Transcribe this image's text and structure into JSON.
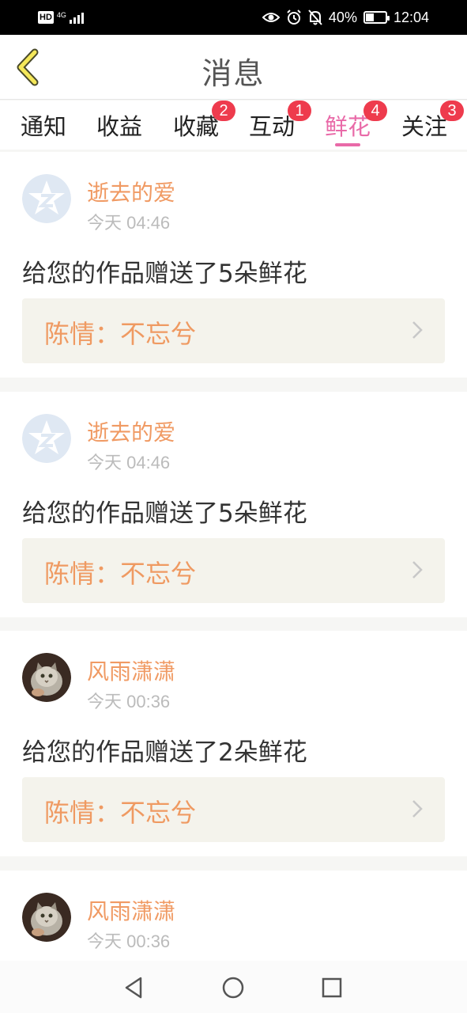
{
  "status_bar": {
    "hd": "HD",
    "network": "4G",
    "battery": "40%",
    "battery_level": 0.4,
    "time": "12:04"
  },
  "header": {
    "title": "消息",
    "back_icon": "chevron-left-icon"
  },
  "tabs": [
    {
      "label": "通知",
      "badge": ""
    },
    {
      "label": "收益",
      "badge": ""
    },
    {
      "label": "收藏",
      "badge": "2"
    },
    {
      "label": "互动",
      "badge": "1"
    },
    {
      "label": "鲜花",
      "badge": "4",
      "active": true
    },
    {
      "label": "关注",
      "badge": "3"
    }
  ],
  "messages": [
    {
      "user": "逝去的爱",
      "time": "今天 04:46",
      "text": "给您的作品赠送了5朵鲜花",
      "work": "陈情：不忘兮",
      "avatar": "qq-default-avatar"
    },
    {
      "user": "逝去的爱",
      "time": "今天 04:46",
      "text": "给您的作品赠送了5朵鲜花",
      "work": "陈情：不忘兮",
      "avatar": "qq-default-avatar"
    },
    {
      "user": "风雨潇潇",
      "time": "今天 00:36",
      "text": "给您的作品赠送了2朵鲜花",
      "work": "陈情：不忘兮",
      "avatar": "cat-photo-avatar"
    },
    {
      "user": "风雨潇潇",
      "time": "今天 00:36",
      "text": "",
      "work": "",
      "avatar": "cat-photo-avatar"
    }
  ],
  "nav_bar": {
    "back": "triangle-back-icon",
    "home": "circle-home-icon",
    "recents": "square-recents-icon"
  },
  "colors": {
    "accent": "#e96aa8",
    "username": "#f09a63",
    "badge": "#ee3b4d",
    "work_bg": "#f4f3ec"
  }
}
